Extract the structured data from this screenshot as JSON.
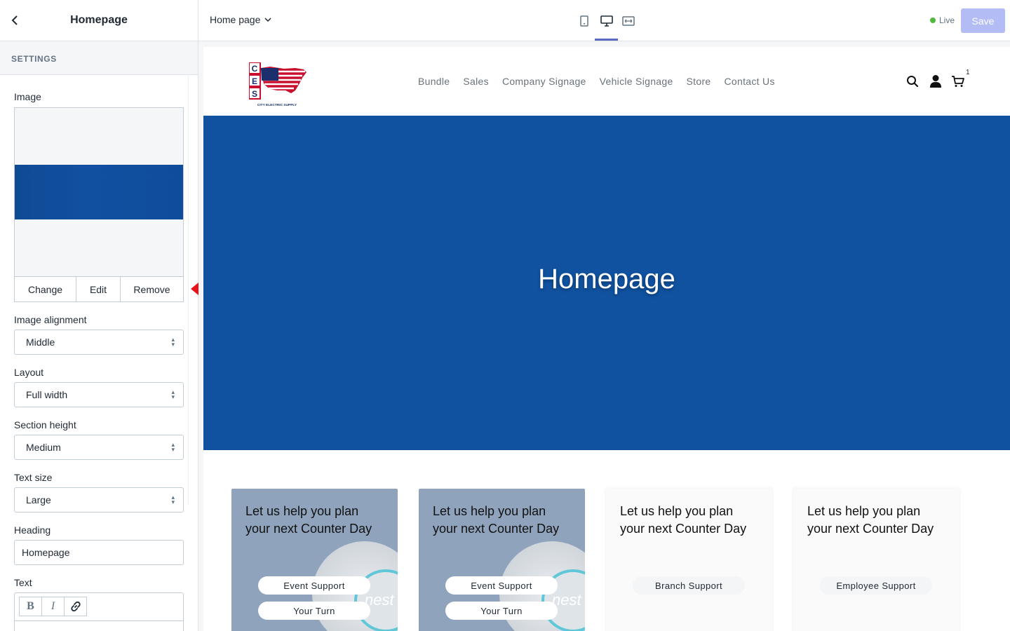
{
  "sidebar": {
    "title": "Homepage",
    "section_label": "SETTINGS",
    "image": {
      "label": "Image",
      "change_label": "Change",
      "edit_label": "Edit",
      "remove_label": "Remove"
    },
    "image_alignment": {
      "label": "Image alignment",
      "value": "Middle"
    },
    "layout": {
      "label": "Layout",
      "value": "Full width"
    },
    "section_height": {
      "label": "Section height",
      "value": "Medium"
    },
    "text_size": {
      "label": "Text size",
      "value": "Large"
    },
    "heading": {
      "label": "Heading",
      "value": "Homepage"
    },
    "text": {
      "label": "Text",
      "bold": "B",
      "italic": "I"
    }
  },
  "topbar": {
    "page_select": "Home page",
    "live_label": "Live",
    "save_label": "Save",
    "accent_color": "#5c6ac4",
    "live_color": "#50b83c"
  },
  "site": {
    "logo_letters": [
      "C",
      "E",
      "S"
    ],
    "logo_caption": "CITY ELECTRIC SUPPLY",
    "nav": [
      "Bundle",
      "Sales",
      "Company Signage",
      "Vehicle Signage",
      "Store",
      "Contact Us"
    ],
    "cart_count": "1",
    "hero_heading": "Homepage",
    "hero_color": "#1052a0",
    "cards": [
      {
        "heading": "Let us help you plan your next Counter Day",
        "buttons": [
          "Event Support",
          "Your Turn"
        ],
        "speaker_text": "nest"
      },
      {
        "heading": "Let us help you plan your next Counter Day",
        "buttons": [
          "Event Support",
          "Your Turn"
        ],
        "speaker_text": "nest"
      },
      {
        "heading": "Let us help you plan your next Counter Day",
        "buttons": [
          "Branch Support"
        ]
      },
      {
        "heading": "Let us help you plan your next Counter Day",
        "buttons": [
          "Employee Support"
        ]
      }
    ]
  }
}
